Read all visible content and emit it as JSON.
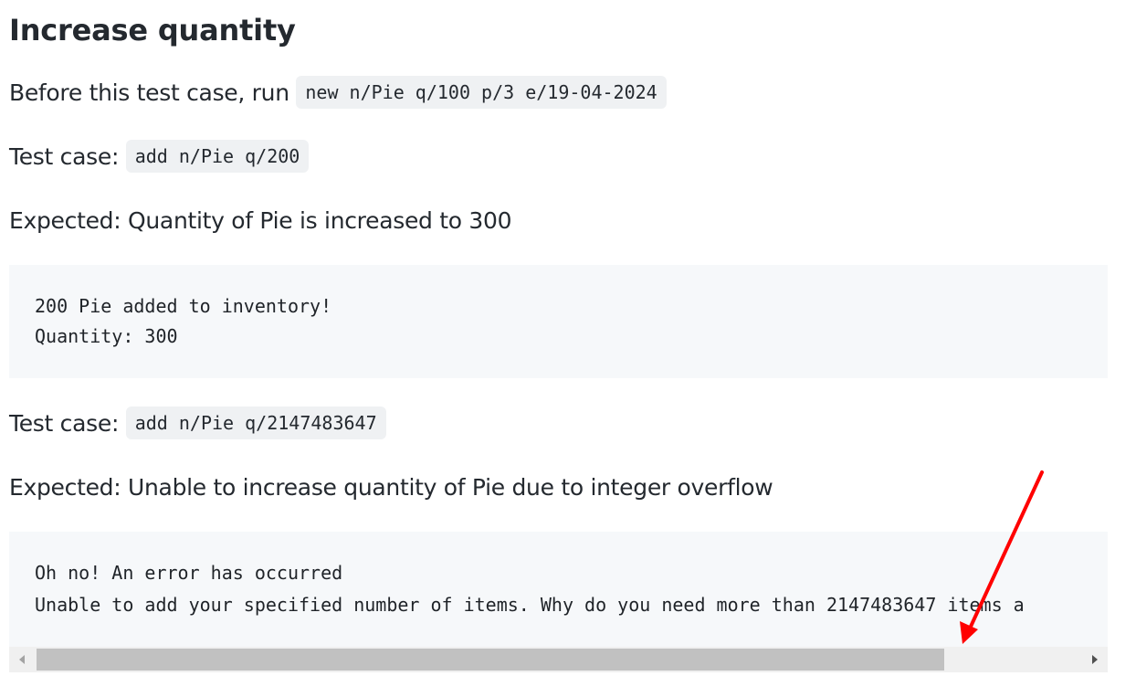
{
  "heading": "Increase quantity",
  "before": {
    "text": "Before this test case, run ",
    "code": "new n/Pie q/100 p/3 e/19-04-2024"
  },
  "test1": {
    "label": "Test case: ",
    "code": "add n/Pie q/200"
  },
  "expected1": "Expected: Quantity of Pie is increased to 300",
  "output1": {
    "line1": "200 Pie added to inventory!",
    "line2": "Quantity: 300"
  },
  "test2": {
    "label": "Test case: ",
    "code": "add n/Pie q/2147483647"
  },
  "expected2": "Expected: Unable to increase quantity of Pie due to integer overflow",
  "output2": {
    "line1": "Oh no! An error has occurred",
    "line2": "Unable to add your specified number of items. Why do you need more than 2147483647 items a"
  },
  "scrollbar": {
    "thumb_fraction": 0.87,
    "left_icon": "triangle-left-icon",
    "right_icon": "triangle-right-icon"
  },
  "annotation": {
    "color": "#ff0000",
    "icon": "red-arrow-annotation"
  }
}
